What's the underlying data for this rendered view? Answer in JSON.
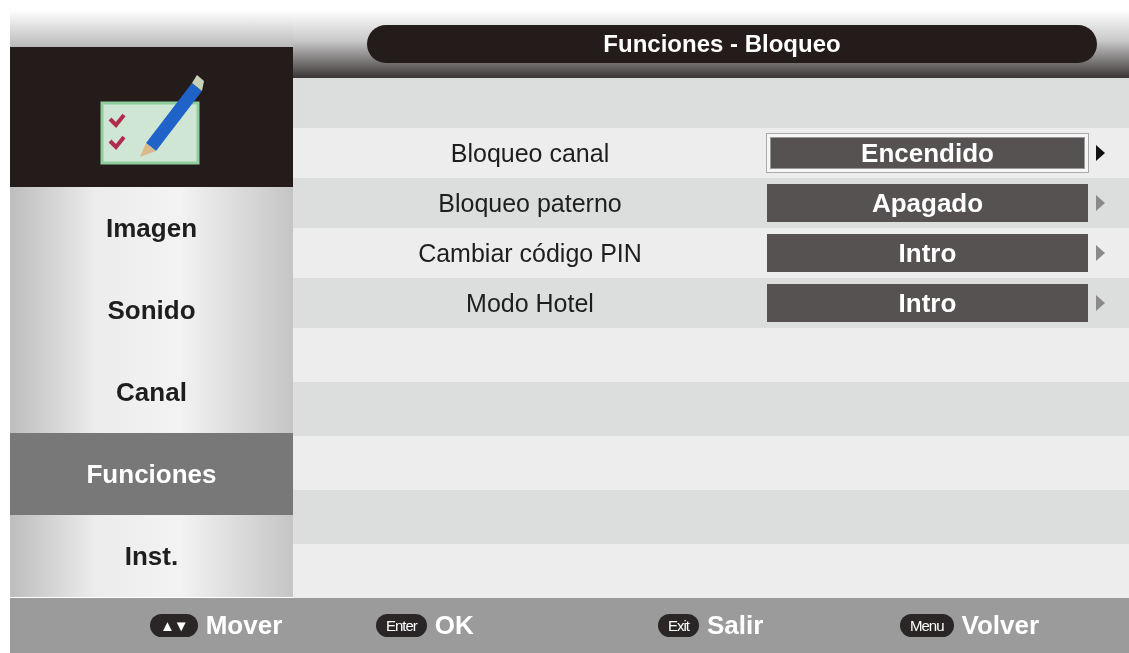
{
  "header": {
    "title": "Funciones - Bloqueo"
  },
  "sidebar": {
    "items": [
      {
        "label": "Imagen",
        "selected": false
      },
      {
        "label": "Sonido",
        "selected": false
      },
      {
        "label": "Canal",
        "selected": false
      },
      {
        "label": "Funciones",
        "selected": true
      },
      {
        "label": "Inst.",
        "selected": false
      }
    ]
  },
  "settings": [
    {
      "label": "Bloqueo canal",
      "value": "Encendido",
      "selected": true
    },
    {
      "label": "Bloqueo paterno",
      "value": "Apagado",
      "selected": false
    },
    {
      "label": "Cambiar código PIN",
      "value": "Intro",
      "selected": false
    },
    {
      "label": "Modo Hotel",
      "value": "Intro",
      "selected": false
    }
  ],
  "footer": {
    "hints": [
      {
        "key": "▲▼",
        "action": "Mover"
      },
      {
        "key": "Enter",
        "action": "OK"
      },
      {
        "key": "Exit",
        "action": "Salir"
      },
      {
        "key": "Menu",
        "action": "Volver"
      }
    ]
  }
}
